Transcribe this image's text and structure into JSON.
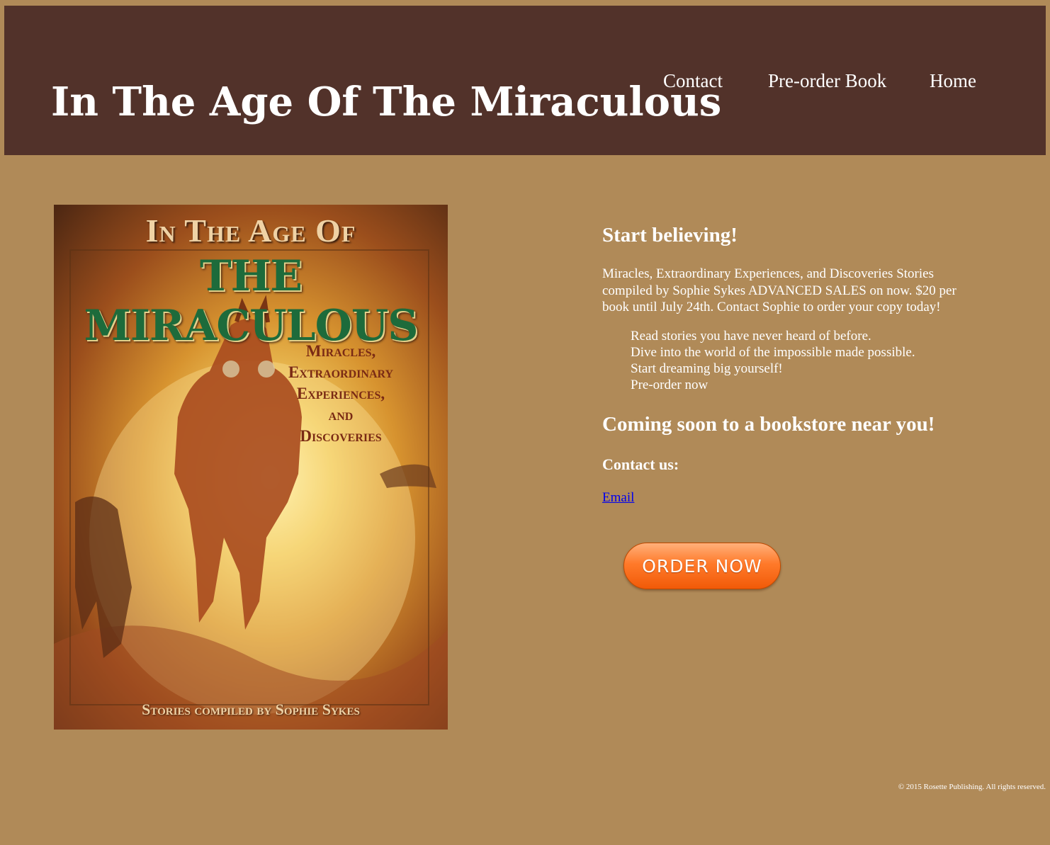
{
  "site": {
    "title": "In The Age Of The Miraculous"
  },
  "nav": {
    "items": [
      {
        "label": "Contact"
      },
      {
        "label": "Pre-order Book"
      },
      {
        "label": "Home"
      }
    ]
  },
  "cover": {
    "title_top": "In The Age Of",
    "title_main": "THE MIRACULOUS",
    "subtitle_lines": [
      "Miracles,",
      "Extraordinary",
      "Experiences,",
      "and",
      "Discoveries"
    ],
    "credit": "Stories compiled by Sophie Sykes"
  },
  "main": {
    "heading_believe": "Start believing!",
    "intro": "Miracles, Extraordinary Experiences, and Discoveries Stories compiled by Sophie Sykes ADVANCED SALES on now. $20 per book until July 24th. Contact Sophie to order your copy today!",
    "features": [
      "Read stories you have never heard of before.",
      "Dive into the world of the impossible made possible.",
      "Start dreaming big yourself!",
      "Pre-order now"
    ],
    "heading_coming": "Coming soon to a bookstore near you!",
    "heading_contact": "Contact us:",
    "email_label": "Email",
    "order_button_label": "ORDER NOW"
  },
  "footer": {
    "copyright": "© 2015 Rosette Publishing. All rights reserved."
  },
  "colors": {
    "page_background": "#b08a58",
    "header_background": "#52322a",
    "order_button": "#ff6a10",
    "link": "#0000ee"
  }
}
